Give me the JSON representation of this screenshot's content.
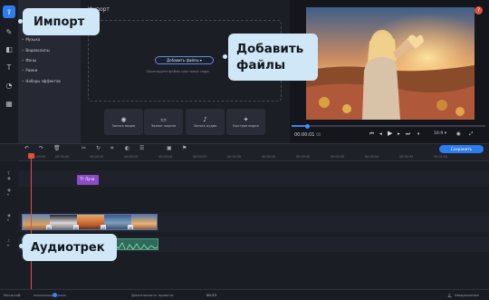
{
  "import_panel": {
    "title": "Импорт",
    "categories": [
      "Музыка",
      "Видеоклипы",
      "Фоны",
      "Рамки",
      "Наборы эффектов"
    ],
    "add_files_button": "Добавить файлы",
    "drop_hint": "Перетащите файлы или папки сюда",
    "quick_buttons": [
      {
        "label": "Запись видео",
        "icon": "camera-icon"
      },
      {
        "label": "Захват экрана",
        "icon": "monitor-icon"
      },
      {
        "label": "Запись аудио",
        "icon": "microphone-icon"
      },
      {
        "label": "Быстрое видео",
        "icon": "magic-icon"
      }
    ]
  },
  "player": {
    "time": "00:00:01",
    "time_fraction": "00",
    "aspect_ratio": "16:9",
    "progress": 0.08,
    "help": "?"
  },
  "timeline": {
    "save_button": "Сохранить",
    "ruler": [
      "00:00:00",
      "00:00:05",
      "00:00:10",
      "00:00:15",
      "00:00:20",
      "00:00:25",
      "00:00:30",
      "00:00:35",
      "00:00:40",
      "00:00:45",
      "00:00:50",
      "00:00:55",
      "00:01:00"
    ],
    "title_clip": "Тт Лучи"
  },
  "statusbar": {
    "zoom_label": "Масштаб:",
    "zoom_level": 0.65,
    "duration_label": "Длительность проекта:",
    "duration": "00:23",
    "notifications": "Уведомления"
  },
  "callouts": {
    "import": "Импорт",
    "add_files": "Добавить файлы",
    "audio_track": "Аудиотрек"
  },
  "colors": {
    "accent": "#2b7df0",
    "callout": "#cfe7f6",
    "playhead": "#e0503c",
    "title_clip": "#8d4bc8",
    "audio_clip": "#2f6a5a"
  }
}
